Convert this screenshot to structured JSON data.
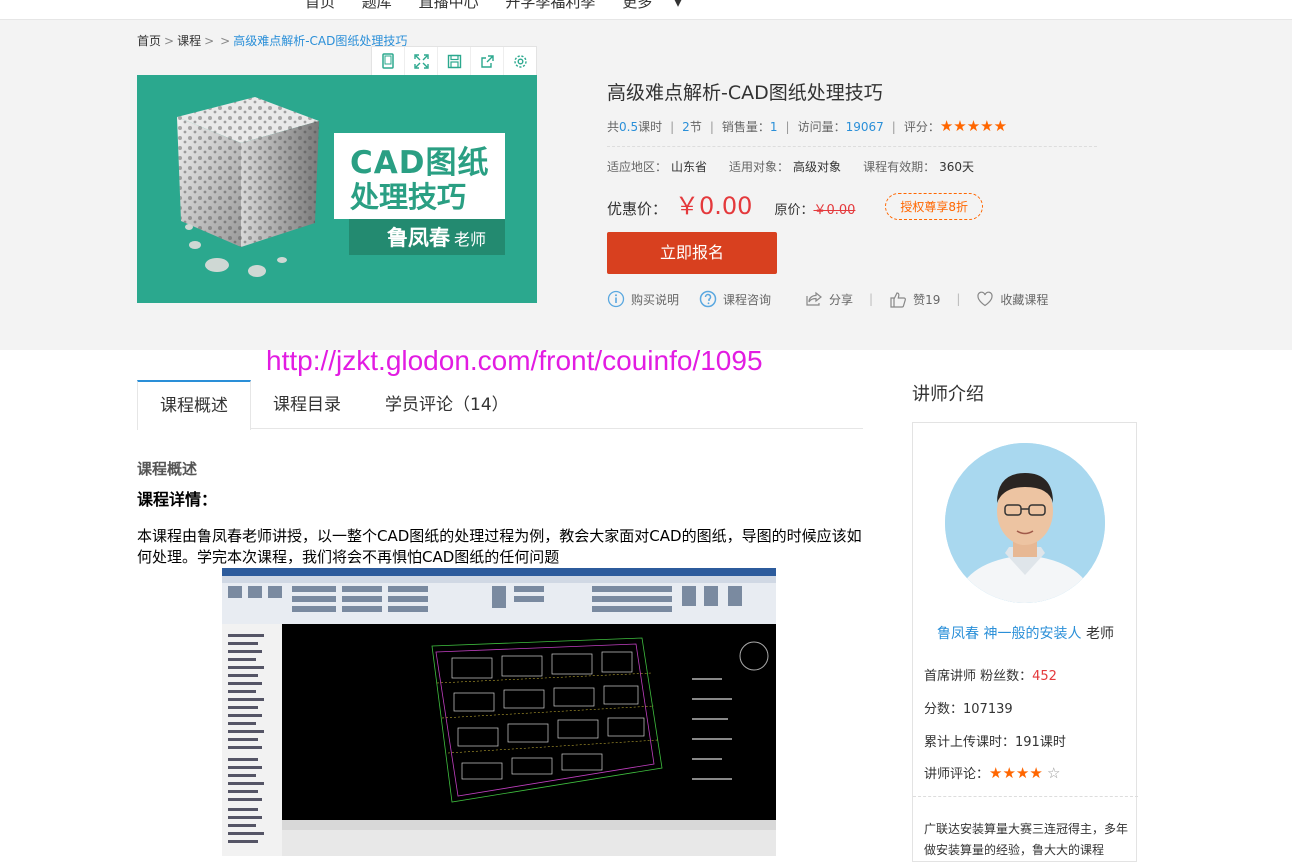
{
  "topnav": {
    "items": [
      "首页",
      "题库",
      "直播中心",
      "开学季福利季",
      "更多"
    ]
  },
  "breadcrumb": {
    "home": "首页",
    "course": "课程",
    "current": "高级难点解析-CAD图纸处理技巧"
  },
  "toolbar_icons": [
    "tablet-icon",
    "fullscreen-icon",
    "save-icon",
    "share-icon",
    "settings-icon"
  ],
  "cover": {
    "line1": "CAD图纸",
    "line2": "处理技巧",
    "teacher": "鲁凤春",
    "teacher_suffix": "老师",
    "bg_color": "#2ba88e"
  },
  "course": {
    "title": "高级难点解析-CAD图纸处理技巧",
    "total_prefix": "共",
    "hours": "0.5",
    "hours_unit": "课时",
    "sections": "2",
    "sections_unit": "节",
    "sales_label": "销售量：",
    "sales": "1",
    "visits_label": "访问量：",
    "visits": "19067",
    "rating_label": "评分：",
    "rating_stars": "★★★★★",
    "region_label": "适应地区：",
    "region": "山东省",
    "audience_label": "适用对象：",
    "audience": "高级对象",
    "validity_label": "课程有效期：",
    "validity": "360天",
    "price_label": "优惠价：",
    "price": "￥0.00",
    "orig_label": "原价：",
    "orig_price": "￥0.00",
    "badge": "授权尊享8折",
    "enroll": "立即报名",
    "actions": {
      "purchase_info": "购买说明",
      "consult": "课程咨询",
      "share": "分享",
      "like": "赞19",
      "favorite": "收藏课程"
    },
    "accent": "#d8401f"
  },
  "overlay_url": "http://jzkt.glodon.com/front/couinfo/1095",
  "tabs": [
    "课程概述",
    "课程目录",
    "学员评论（14）"
  ],
  "content": {
    "section_title": "课程概述",
    "details_title": "课程详情：",
    "description": "本课程由鲁凤春老师讲授，以一整个CAD图纸的处理过程为例，教会大家面对CAD的图纸，导图的时候应该如何处理。学完本次课程，我们将会不再惧怕CAD图纸的任何问题"
  },
  "instructor": {
    "heading": "讲师介绍",
    "name_link": "鲁凤春 神一般的安装人",
    "name_suffix": "老师",
    "title_fans_label": "首席讲师 粉丝数：",
    "fans": "452",
    "score_label": "分数：",
    "score": "107139",
    "uploaded_label": "累计上传课时：",
    "uploaded": "191课时",
    "review_label": "讲师评论：",
    "review_stars": "★★★★",
    "review_empty": "☆",
    "bio": "广联达安装算量大赛三连冠得主，多年做安装算量的经验，鲁大大的课程"
  }
}
